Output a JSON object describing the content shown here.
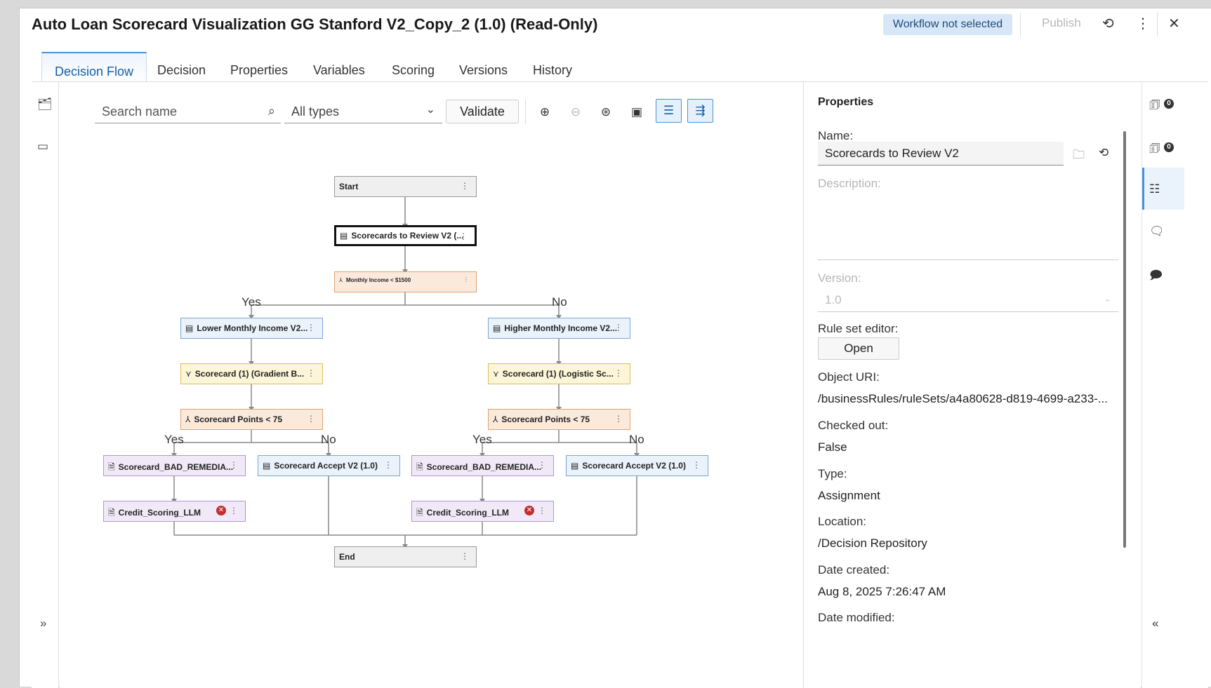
{
  "window": {
    "title": "Auto Loan Scorecard Visualization GG Stanford V2_Copy_2 (1.0) (Read-Only)",
    "workflow_badge": "Workflow not selected",
    "publish_label": "Publish"
  },
  "tabs": [
    "Decision Flow",
    "Decision",
    "Properties",
    "Variables",
    "Scoring",
    "Versions",
    "History"
  ],
  "toolbar": {
    "search_placeholder": "Search name",
    "type_filter": "All types",
    "validate_label": "Validate"
  },
  "flow": {
    "start": "Start",
    "ruleset_main": "Scorecards to Review V2 (...",
    "cond_income": "Monthly Income < $1500",
    "yes": "Yes",
    "no": "No",
    "lower_income": "Lower Monthly Income V2...",
    "higher_income": "Higher Monthly Income V2...",
    "scorecard_gb": "Scorecard (1) (Gradient B...",
    "scorecard_lr": "Scorecard (1) (Logistic Sc...",
    "points_left": "Scorecard Points < 75",
    "points_right": "Scorecard Points < 75",
    "bad_remedia_left": "Scorecard_BAD_REMEDIA...",
    "accept_left": "Scorecard Accept V2 (1.0)",
    "bad_remedia_right": "Scorecard_BAD_REMEDIA...",
    "accept_right": "Scorecard Accept V2 (1.0)",
    "llm_left": "Credit_Scoring_LLM",
    "llm_right": "Credit_Scoring_LLM",
    "end": "End"
  },
  "properties": {
    "title": "Properties",
    "name_label": "Name:",
    "name_value": "Scorecards to Review V2",
    "description_label": "Description:",
    "version_label": "Version:",
    "version_value": "1.0",
    "ruleset_editor_label": "Rule set editor:",
    "open_label": "Open",
    "object_uri_label": "Object URI:",
    "object_uri_value": "/businessRules/ruleSets/a4a80628-d819-4699-a233-...",
    "checked_out_label": "Checked out:",
    "checked_out_value": "False",
    "type_label": "Type:",
    "type_value": "Assignment",
    "location_label": "Location:",
    "location_value": "/Decision Repository",
    "date_created_label": "Date created:",
    "date_created_value": "Aug 8, 2025 7:26:47 AM",
    "date_modified_label": "Date modified:"
  },
  "right_rail": {
    "count_1": "0",
    "count_2": "0"
  },
  "colors": {
    "accent": "#1460aa",
    "ruleset": "#eaf2fb",
    "condition": "#fbe9dc",
    "model": "#fcf5d8",
    "code": "#f1e9f8",
    "error": "#c0302d"
  },
  "icons": [
    "search-icon",
    "chevron-down-icon",
    "zoom-in-icon",
    "zoom-out-icon",
    "zoom-fit-icon",
    "overview-icon",
    "layout-icon",
    "wrap-icon",
    "refresh-icon",
    "more-icon",
    "close-icon",
    "folder-icon",
    "error-icon",
    "expand-icon",
    "collapse-icon"
  ]
}
